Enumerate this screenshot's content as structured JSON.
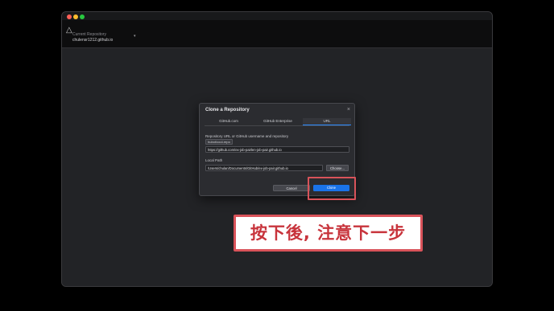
{
  "window": {
    "repo_label": "Current Repository",
    "repo_name": "chulensr1212.github.io"
  },
  "dialog": {
    "title": "Clone a Repository",
    "tabs": [
      {
        "label": "GitHub.com"
      },
      {
        "label": "GitHub Enterprise"
      },
      {
        "label": "URL",
        "selected": true
      }
    ],
    "url_label": "Repository URL or GitHub username and repository",
    "url_hint": "hubot/cool-repo",
    "url_value": "https://github.com/ex-job-pairlen-job-pair.github.io",
    "path_label": "Local Path",
    "path_value": "/Users/chulan/Documents/GitHub/ex-job-pair.github.io",
    "choose_label": "Choose...",
    "cancel_label": "Cancel",
    "clone_label": "Clone"
  },
  "annotation": {
    "callout_text": "按下後, 注意下一步",
    "highlight_color": "#d9535a"
  },
  "colors": {
    "accent": "#1a73e8",
    "annotation_red": "#d9535a"
  }
}
